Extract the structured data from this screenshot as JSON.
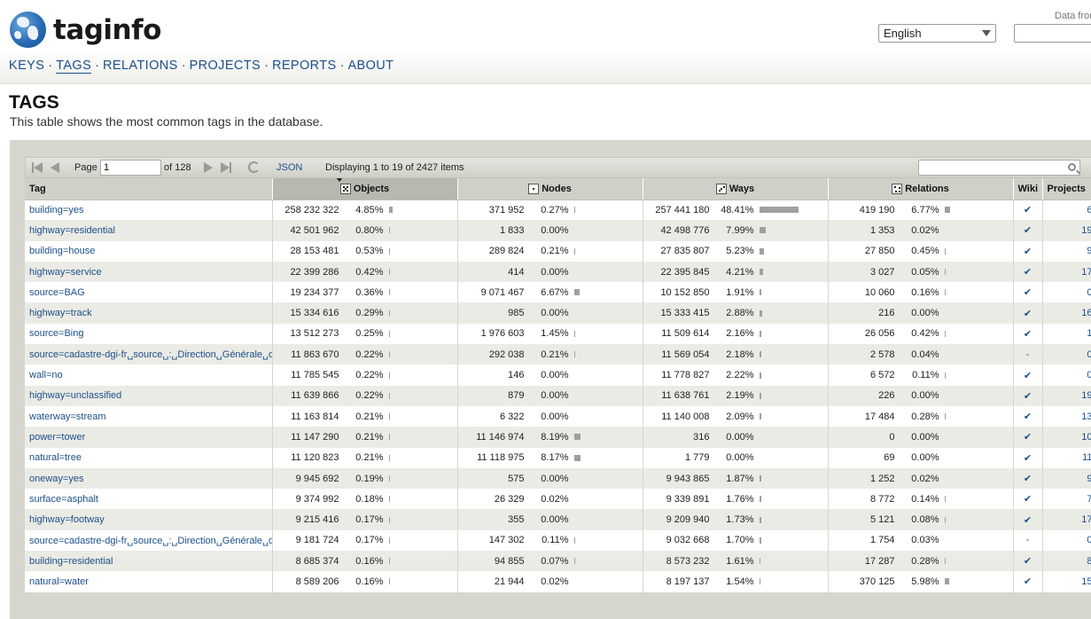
{
  "app": {
    "logo_text": "taginfo",
    "data_from": "Data from"
  },
  "nav": [
    {
      "label": "KEYS",
      "active": false
    },
    {
      "label": "TAGS",
      "active": true
    },
    {
      "label": "RELATIONS",
      "active": false
    },
    {
      "label": "PROJECTS",
      "active": false
    },
    {
      "label": "REPORTS",
      "active": false
    },
    {
      "label": "ABOUT",
      "active": false
    }
  ],
  "language": {
    "selected": "English"
  },
  "page": {
    "title": "TAGS",
    "description": "This table shows the most common tags in the database."
  },
  "toolbar": {
    "page_label": "Page",
    "page_value": "1",
    "of_label": "of 128",
    "json_label": "JSON",
    "displaying": "Displaying 1 to 19 of 2427 items"
  },
  "columns": {
    "tag": "Tag",
    "objects": "Objects",
    "nodes": "Nodes",
    "ways": "Ways",
    "relations": "Relations",
    "wiki": "Wiki",
    "projects": "Projects"
  },
  "rows": [
    {
      "tag": "building=yes",
      "objects": "258 232 322",
      "objects_pct": "4.85%",
      "objects_frac": 0.0485,
      "nodes": "371 952",
      "nodes_pct": "0.27%",
      "nodes_frac": 0.0027,
      "ways": "257 441 180",
      "ways_pct": "48.41%",
      "ways_frac": 0.4841,
      "relations": "419 190",
      "relations_pct": "6.77%",
      "relations_frac": 0.0677,
      "wiki": "✔",
      "projects": "6"
    },
    {
      "tag": "highway=residential",
      "objects": "42 501 962",
      "objects_pct": "0.80%",
      "objects_frac": 0.008,
      "nodes": "1 833",
      "nodes_pct": "0.00%",
      "nodes_frac": 0,
      "ways": "42 498 776",
      "ways_pct": "7.99%",
      "ways_frac": 0.0799,
      "relations": "1 353",
      "relations_pct": "0.02%",
      "relations_frac": 0.0002,
      "wiki": "✔",
      "projects": "19"
    },
    {
      "tag": "building=house",
      "objects": "28 153 481",
      "objects_pct": "0.53%",
      "objects_frac": 0.0053,
      "nodes": "289 824",
      "nodes_pct": "0.21%",
      "nodes_frac": 0.0021,
      "ways": "27 835 807",
      "ways_pct": "5.23%",
      "ways_frac": 0.0523,
      "relations": "27 850",
      "relations_pct": "0.45%",
      "relations_frac": 0.0045,
      "wiki": "✔",
      "projects": "9"
    },
    {
      "tag": "highway=service",
      "objects": "22 399 286",
      "objects_pct": "0.42%",
      "objects_frac": 0.0042,
      "nodes": "414",
      "nodes_pct": "0.00%",
      "nodes_frac": 0,
      "ways": "22 395 845",
      "ways_pct": "4.21%",
      "ways_frac": 0.0421,
      "relations": "3 027",
      "relations_pct": "0.05%",
      "relations_frac": 0.0005,
      "wiki": "✔",
      "projects": "17"
    },
    {
      "tag": "source=BAG",
      "objects": "19 234 377",
      "objects_pct": "0.36%",
      "objects_frac": 0.0036,
      "nodes": "9 071 467",
      "nodes_pct": "6.67%",
      "nodes_frac": 0.0667,
      "ways": "10 152 850",
      "ways_pct": "1.91%",
      "ways_frac": 0.0191,
      "relations": "10 060",
      "relations_pct": "0.16%",
      "relations_frac": 0.0016,
      "wiki": "✔",
      "projects": "0"
    },
    {
      "tag": "highway=track",
      "objects": "15 334 616",
      "objects_pct": "0.29%",
      "objects_frac": 0.0029,
      "nodes": "985",
      "nodes_pct": "0.00%",
      "nodes_frac": 0,
      "ways": "15 333 415",
      "ways_pct": "2.88%",
      "ways_frac": 0.0288,
      "relations": "216",
      "relations_pct": "0.00%",
      "relations_frac": 0,
      "wiki": "✔",
      "projects": "16"
    },
    {
      "tag": "source=Bing",
      "objects": "13 512 273",
      "objects_pct": "0.25%",
      "objects_frac": 0.0025,
      "nodes": "1 976 603",
      "nodes_pct": "1.45%",
      "nodes_frac": 0.0145,
      "ways": "11 509 614",
      "ways_pct": "2.16%",
      "ways_frac": 0.0216,
      "relations": "26 056",
      "relations_pct": "0.42%",
      "relations_frac": 0.0042,
      "wiki": "✔",
      "projects": "1"
    },
    {
      "tag": "source=cadastre-dgi-fr␣source␣:␣Direction␣Générale␣des␣Impôts",
      "objects": "11 863 670",
      "objects_pct": "0.22%",
      "objects_frac": 0.0022,
      "nodes": "292 038",
      "nodes_pct": "0.21%",
      "nodes_frac": 0.0021,
      "ways": "11 569 054",
      "ways_pct": "2.18%",
      "ways_frac": 0.0218,
      "relations": "2 578",
      "relations_pct": "0.04%",
      "relations_frac": 0.0004,
      "wiki": "-",
      "projects": "0"
    },
    {
      "tag": "wall=no",
      "objects": "11 785 545",
      "objects_pct": "0.22%",
      "objects_frac": 0.0022,
      "nodes": "146",
      "nodes_pct": "0.00%",
      "nodes_frac": 0,
      "ways": "11 778 827",
      "ways_pct": "2.22%",
      "ways_frac": 0.0222,
      "relations": "6 572",
      "relations_pct": "0.11%",
      "relations_frac": 0.0011,
      "wiki": "✔",
      "projects": "0"
    },
    {
      "tag": "highway=unclassified",
      "objects": "11 639 866",
      "objects_pct": "0.22%",
      "objects_frac": 0.0022,
      "nodes": "879",
      "nodes_pct": "0.00%",
      "nodes_frac": 0,
      "ways": "11 638 761",
      "ways_pct": "2.19%",
      "ways_frac": 0.0219,
      "relations": "226",
      "relations_pct": "0.00%",
      "relations_frac": 0,
      "wiki": "✔",
      "projects": "19"
    },
    {
      "tag": "waterway=stream",
      "objects": "11 163 814",
      "objects_pct": "0.21%",
      "objects_frac": 0.0021,
      "nodes": "6 322",
      "nodes_pct": "0.00%",
      "nodes_frac": 0,
      "ways": "11 140 008",
      "ways_pct": "2.09%",
      "ways_frac": 0.0209,
      "relations": "17 484",
      "relations_pct": "0.28%",
      "relations_frac": 0.0028,
      "wiki": "✔",
      "projects": "13"
    },
    {
      "tag": "power=tower",
      "objects": "11 147 290",
      "objects_pct": "0.21%",
      "objects_frac": 0.0021,
      "nodes": "11 146 974",
      "nodes_pct": "8.19%",
      "nodes_frac": 0.0819,
      "ways": "316",
      "ways_pct": "0.00%",
      "ways_frac": 0,
      "relations": "0",
      "relations_pct": "0.00%",
      "relations_frac": 0,
      "wiki": "✔",
      "projects": "10"
    },
    {
      "tag": "natural=tree",
      "objects": "11 120 823",
      "objects_pct": "0.21%",
      "objects_frac": 0.0021,
      "nodes": "11 118 975",
      "nodes_pct": "8.17%",
      "nodes_frac": 0.0817,
      "ways": "1 779",
      "ways_pct": "0.00%",
      "ways_frac": 0,
      "relations": "69",
      "relations_pct": "0.00%",
      "relations_frac": 0,
      "wiki": "✔",
      "projects": "11"
    },
    {
      "tag": "oneway=yes",
      "objects": "9 945 692",
      "objects_pct": "0.19%",
      "objects_frac": 0.0019,
      "nodes": "575",
      "nodes_pct": "0.00%",
      "nodes_frac": 0,
      "ways": "9 943 865",
      "ways_pct": "1.87%",
      "ways_frac": 0.0187,
      "relations": "1 252",
      "relations_pct": "0.02%",
      "relations_frac": 0.0002,
      "wiki": "✔",
      "projects": "9"
    },
    {
      "tag": "surface=asphalt",
      "objects": "9 374 992",
      "objects_pct": "0.18%",
      "objects_frac": 0.0018,
      "nodes": "26 329",
      "nodes_pct": "0.02%",
      "nodes_frac": 0.0002,
      "ways": "9 339 891",
      "ways_pct": "1.76%",
      "ways_frac": 0.0176,
      "relations": "8 772",
      "relations_pct": "0.14%",
      "relations_frac": 0.0014,
      "wiki": "✔",
      "projects": "7"
    },
    {
      "tag": "highway=footway",
      "objects": "9 215 416",
      "objects_pct": "0.17%",
      "objects_frac": 0.0017,
      "nodes": "355",
      "nodes_pct": "0.00%",
      "nodes_frac": 0,
      "ways": "9 209 940",
      "ways_pct": "1.73%",
      "ways_frac": 0.0173,
      "relations": "5 121",
      "relations_pct": "0.08%",
      "relations_frac": 0.0008,
      "wiki": "✔",
      "projects": "17"
    },
    {
      "tag": "source=cadastre-dgi-fr␣source␣:␣Direction␣Générale␣des␣Finances␣Publiques",
      "objects": "9 181 724",
      "objects_pct": "0.17%",
      "objects_frac": 0.0017,
      "nodes": "147 302",
      "nodes_pct": "0.11%",
      "nodes_frac": 0.0011,
      "ways": "9 032 668",
      "ways_pct": "1.70%",
      "ways_frac": 0.017,
      "relations": "1 754",
      "relations_pct": "0.03%",
      "relations_frac": 0.0003,
      "wiki": "-",
      "projects": "0"
    },
    {
      "tag": "building=residential",
      "objects": "8 685 374",
      "objects_pct": "0.16%",
      "objects_frac": 0.0016,
      "nodes": "94 855",
      "nodes_pct": "0.07%",
      "nodes_frac": 0.0007,
      "ways": "8 573 232",
      "ways_pct": "1.61%",
      "ways_frac": 0.0161,
      "relations": "17 287",
      "relations_pct": "0.28%",
      "relations_frac": 0.0028,
      "wiki": "✔",
      "projects": "8"
    },
    {
      "tag": "natural=water",
      "objects": "8 589 206",
      "objects_pct": "0.16%",
      "objects_frac": 0.0016,
      "nodes": "21 944",
      "nodes_pct": "0.02%",
      "nodes_frac": 0.0002,
      "ways": "8 197 137",
      "ways_pct": "1.54%",
      "ways_frac": 0.0154,
      "relations": "370 125",
      "relations_pct": "5.98%",
      "relations_frac": 0.0598,
      "wiki": "✔",
      "projects": "15"
    }
  ]
}
